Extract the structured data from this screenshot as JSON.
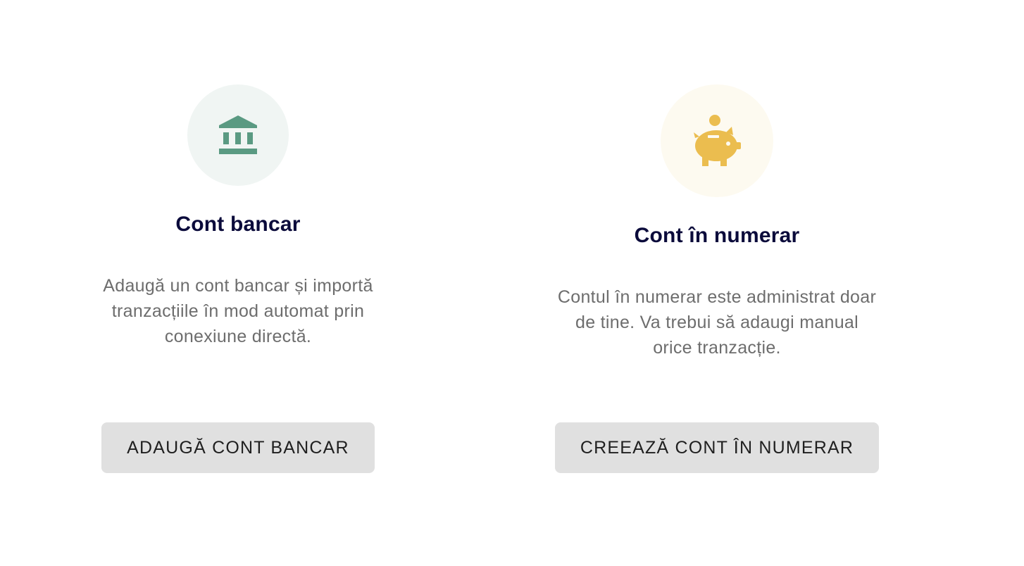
{
  "bank": {
    "icon": "bank-icon",
    "title": "Cont bancar",
    "description": "Adaugă un cont bancar și importă tranzacțiile în mod automat prin conexiune directă.",
    "button_label": "ADAUGĂ CONT BANCAR",
    "accent_color": "#5a9a82"
  },
  "cash": {
    "icon": "piggy-bank-icon",
    "title": "Cont în numerar",
    "description": "Contul în numerar este administrat doar de tine. Va trebui să adaugi manual orice tranzacție.",
    "button_label": "CREEAZĂ CONT ÎN NUMERAR",
    "accent_color": "#ebbd4f"
  }
}
